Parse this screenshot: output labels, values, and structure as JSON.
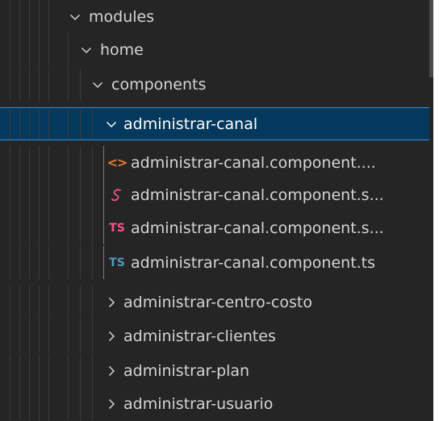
{
  "tree": {
    "rows": [
      {
        "label": "modules",
        "kind": "folder",
        "expanded": true
      },
      {
        "label": "home",
        "kind": "folder",
        "expanded": true
      },
      {
        "label": "components",
        "kind": "folder",
        "expanded": true
      },
      {
        "label": "administrar-canal",
        "kind": "folder",
        "expanded": true,
        "selected": true
      },
      {
        "label": "administrar-canal.component....",
        "kind": "file",
        "icon": "html-file-icon"
      },
      {
        "label": "administrar-canal.component.s...",
        "kind": "file",
        "icon": "scss-file-icon"
      },
      {
        "label": "administrar-canal.component.s...",
        "kind": "file",
        "icon": "ts-spec-file-icon"
      },
      {
        "label": "administrar-canal.component.ts",
        "kind": "file",
        "icon": "ts-file-icon"
      },
      {
        "label": "administrar-centro-costo",
        "kind": "folder",
        "expanded": false
      },
      {
        "label": "administrar-clientes",
        "kind": "folder",
        "expanded": false
      },
      {
        "label": "administrar-plan",
        "kind": "folder",
        "expanded": false
      },
      {
        "label": "administrar-usuario",
        "kind": "folder",
        "expanded": false
      }
    ]
  },
  "icons": {
    "html_glyph": "<>",
    "ts_glyph": "TS"
  },
  "colors": {
    "background": "#252526",
    "text": "#d4d4d4",
    "selection": "#04395e",
    "selection_border": "#2f8fd8",
    "html_icon": "#e37933",
    "scss_icon": "#f55385",
    "ts_spec_icon": "#f55385",
    "ts_icon": "#519aba"
  }
}
